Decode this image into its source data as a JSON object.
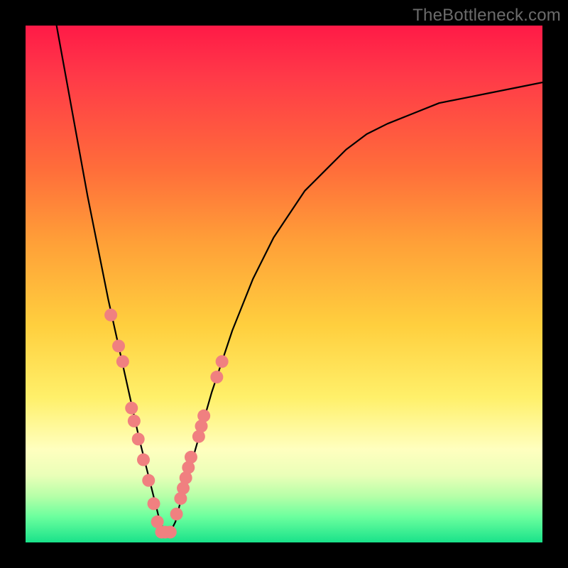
{
  "watermark": "TheBottleneck.com",
  "chart_data": {
    "type": "line",
    "title": "",
    "xlabel": "",
    "ylabel": "",
    "xlim": [
      0,
      100
    ],
    "ylim": [
      0,
      100
    ],
    "curve_x": [
      6,
      8,
      10,
      12,
      14,
      16,
      18,
      20,
      22,
      23,
      24,
      25,
      26,
      27,
      28,
      29,
      30,
      32,
      34,
      36,
      38,
      40,
      42,
      44,
      46,
      48,
      50,
      54,
      58,
      62,
      66,
      70,
      75,
      80,
      85,
      90,
      95,
      100
    ],
    "curve_y": [
      100,
      89,
      78,
      67,
      57,
      47,
      38,
      29,
      20,
      16,
      12,
      8,
      4,
      2,
      2,
      4,
      8,
      15,
      22,
      29,
      35,
      41,
      46,
      51,
      55,
      59,
      62,
      68,
      72,
      76,
      79,
      81,
      83,
      85,
      86,
      87,
      88,
      89
    ],
    "dots_x": [
      16.5,
      18.0,
      18.8,
      20.5,
      21.0,
      21.8,
      22.8,
      23.8,
      24.8,
      25.5,
      26.3,
      27.0,
      28.0,
      29.2,
      30.0,
      30.5,
      31.0,
      31.5,
      32.0,
      33.5,
      34.0,
      34.5,
      37.0,
      38.0
    ],
    "dots_y": [
      44.0,
      38.0,
      35.0,
      26.0,
      23.5,
      20.0,
      16.0,
      12.0,
      7.5,
      4.0,
      2.0,
      2.0,
      2.0,
      5.5,
      8.5,
      10.5,
      12.5,
      14.5,
      16.5,
      20.5,
      22.5,
      24.5,
      32.0,
      35.0
    ],
    "dot_color": "#f08080",
    "curve_color": "#000000"
  }
}
